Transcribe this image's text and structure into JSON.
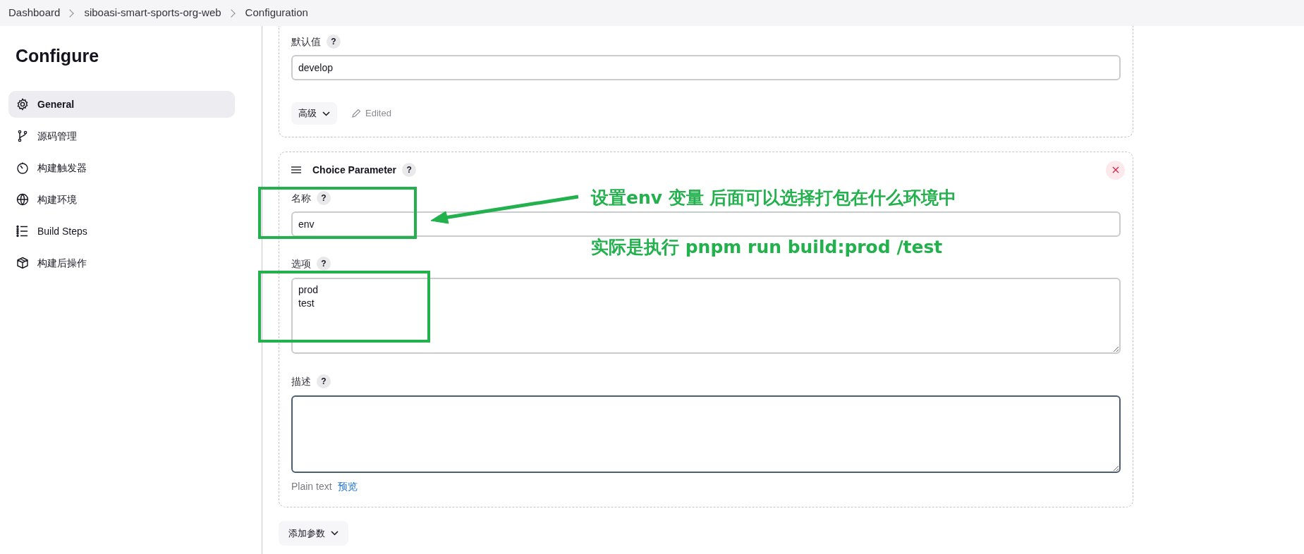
{
  "breadcrumb": [
    {
      "label": "Dashboard"
    },
    {
      "label": "siboasi-smart-sports-org-web"
    },
    {
      "label": "Configuration"
    }
  ],
  "sidebar": {
    "title": "Configure",
    "items": [
      {
        "label": "General",
        "selected": true
      },
      {
        "label": "源码管理",
        "selected": false
      },
      {
        "label": "构建触发器",
        "selected": false
      },
      {
        "label": "构建环境",
        "selected": false
      },
      {
        "label": "Build Steps",
        "selected": false
      },
      {
        "label": "构建后操作",
        "selected": false
      }
    ]
  },
  "string_parameter": {
    "field": {
      "label": "默认值",
      "help": "?",
      "value": "develop"
    },
    "advanced_button": "高级",
    "edited": "Edited"
  },
  "choice_parameter": {
    "title": "Choice Parameter",
    "help": "?",
    "fields": [
      {
        "kind": "input",
        "label": "名称",
        "help": "?",
        "value": "env",
        "focused": false
      },
      {
        "kind": "textarea",
        "label": "选项",
        "help": "?",
        "value": "prod\ntest",
        "focused": false
      },
      {
        "kind": "textarea",
        "label": "描述",
        "help": "?",
        "focused": true
      }
    ],
    "format_hint": "Plain text",
    "preview_link": "预览"
  },
  "add_parameter_button": "添加参数",
  "annotations": [
    {
      "text": "设置env 变量 后面可以选择打包在什么环境中"
    },
    {
      "text": "实际是执行 pnpm run build:prod /test"
    }
  ]
}
